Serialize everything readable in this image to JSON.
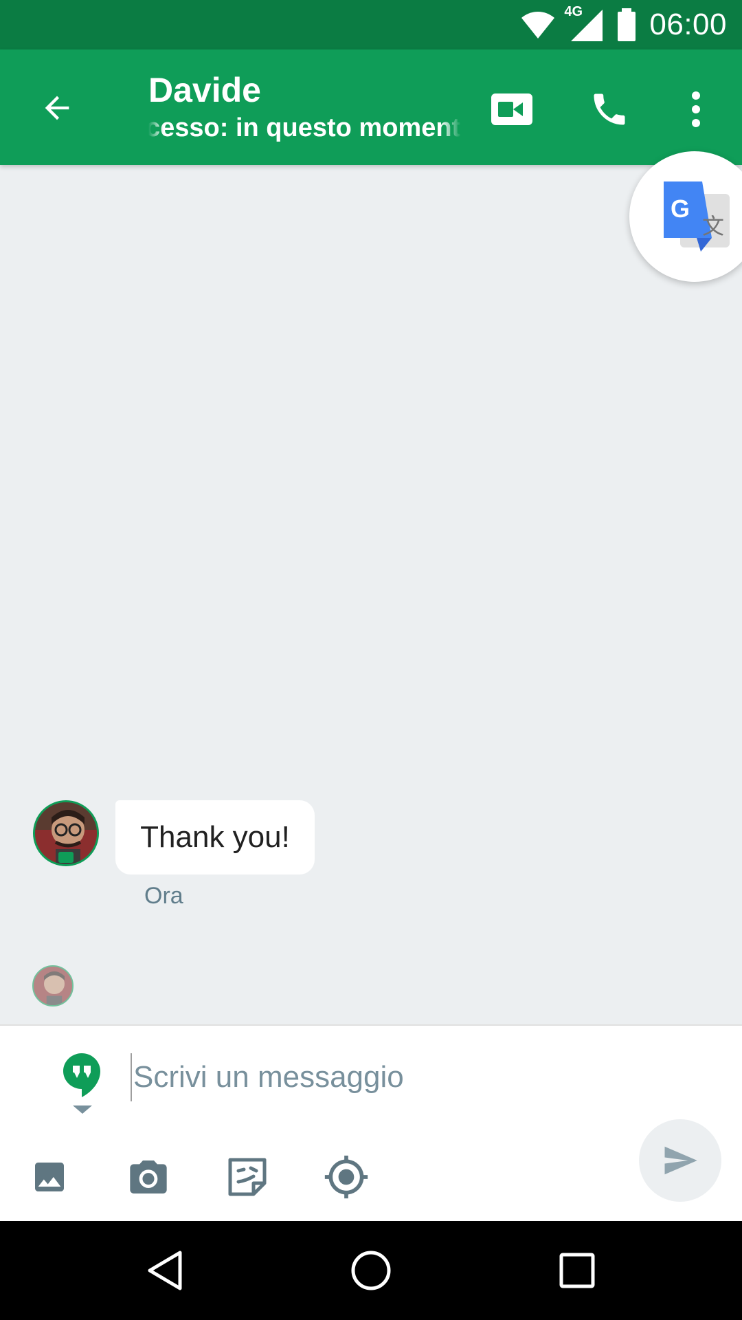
{
  "status_bar": {
    "time": "06:00",
    "network": "4G",
    "icons": [
      "wifi-icon",
      "signal-icon",
      "battery-icon"
    ]
  },
  "app_bar": {
    "title": "Davide",
    "subtitle": "cesso: in questo moment",
    "actions": [
      "video-call-icon",
      "phone-call-icon",
      "more-vert-icon"
    ],
    "back_icon": "arrow-back-icon"
  },
  "floating": {
    "icon": "google-translate-icon",
    "glyph_g": "G",
    "glyph_wen": "文"
  },
  "conversation": {
    "messages": [
      {
        "text": "Thank you!",
        "timestamp": "Ora"
      }
    ]
  },
  "compose": {
    "placeholder": "Scrivi un messaggio",
    "tools": [
      "gallery-icon",
      "camera-icon",
      "sticker-icon",
      "location-icon"
    ],
    "send_icon": "send-icon"
  },
  "nav_bar": {
    "buttons": [
      "nav-back-icon",
      "nav-home-icon",
      "nav-recents-icon"
    ]
  },
  "colors": {
    "status_bar": "#0b7c43",
    "app_bar": "#0f9d58",
    "chat_bg": "#eceff1",
    "icon_grey": "#5f7681"
  }
}
